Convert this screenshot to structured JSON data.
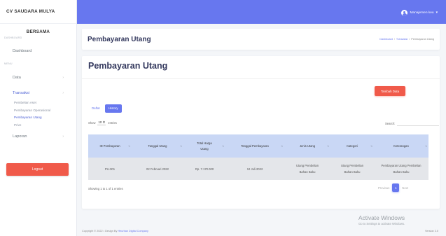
{
  "sidebar": {
    "brand": "CV SAUDARA MULYA",
    "profile_name": "BERSAMA",
    "section_dashboard": "DASHBOARD",
    "dashboard": "Dashboard",
    "section_menu": "MENU",
    "items": [
      {
        "label": "Data",
        "chevron": "›"
      },
      {
        "label": "Transaksi",
        "chevron": "›"
      },
      {
        "label": "Laporan",
        "chevron": "›"
      }
    ],
    "sub_items": [
      "Pembelian Aset",
      "Pembayaran Operasional",
      "Pembayaran Utang",
      "Prive"
    ],
    "logout": "Logout"
  },
  "topbar": {
    "user": "Manajemen keu",
    "caret": "▾",
    "color": "#6777ef"
  },
  "header": {
    "title": "Pembayaran Utang",
    "breadcrumb": [
      "Dashboard",
      "Transaksi",
      "Pembayaran Utang"
    ]
  },
  "main": {
    "title": "Pembayaran Utang",
    "add_button": "Tambah Data",
    "tabs": [
      "Daftar",
      "History"
    ],
    "show_prefix": "Show",
    "show_value": "10",
    "show_suffix": "entries",
    "search_label": "Search:",
    "columns": [
      "ID Pembayaran",
      "Tanggal Utang",
      "Total Harga Utang",
      "Tanggal Pembayaran",
      "Jenis Utang",
      "Kategori",
      "Keterangan"
    ],
    "rows": [
      [
        "PU-001",
        "02 Februari 2022",
        "Rp. 7.170.000",
        "12 Juli 2022",
        "Utang Pembelian Bahan Baku",
        "Utang Pembelian Bahan Baku",
        "Pembayaran Utang Pembelian Bahan Baku"
      ]
    ],
    "info": "Showing 1 to 1 of 1 entries",
    "pagination": {
      "prev": "Previous",
      "page": "1",
      "next": "Next"
    }
  },
  "footer": {
    "copyright": "Copyright © 2022 •",
    "design_by": "Design By",
    "company": "Heurban Digital Company",
    "version": "Version 2.0"
  },
  "watermark": {
    "line1": "Activate Windows",
    "line2": "Go to Settings to activate Windows."
  }
}
